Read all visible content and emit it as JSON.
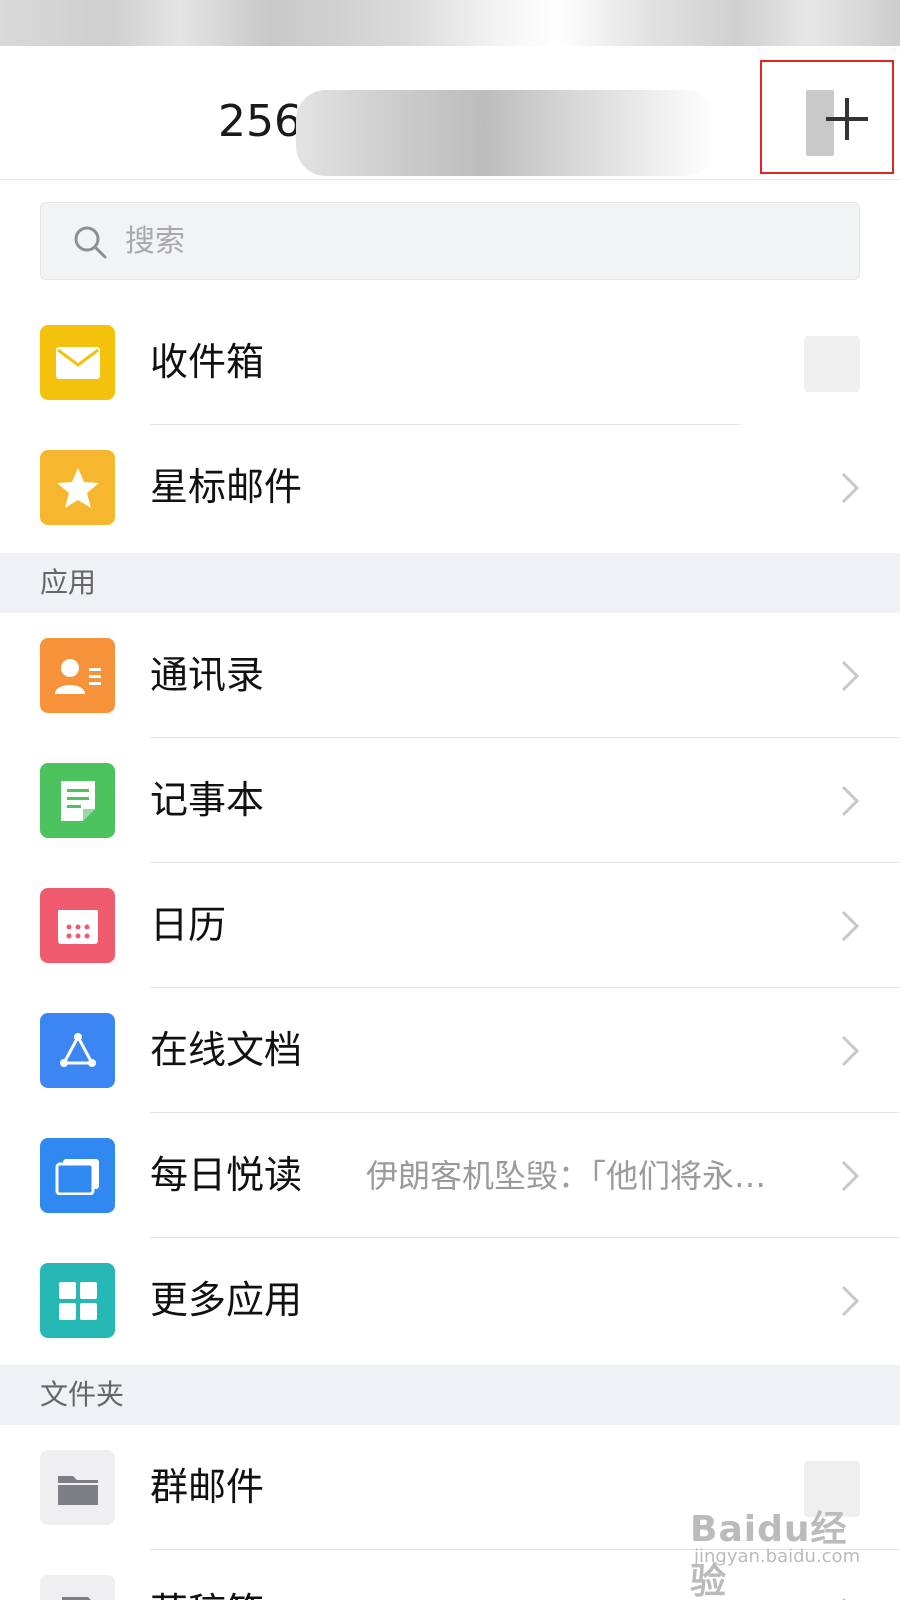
{
  "header": {
    "account_visible_text": "256",
    "add_symbol": "+"
  },
  "search": {
    "placeholder": "搜索"
  },
  "mail_items": [
    {
      "label": "收件箱",
      "icon": "envelope-icon",
      "color": "#f4c20d"
    },
    {
      "label": "星标邮件",
      "icon": "star-icon",
      "color": "#f6b72e"
    }
  ],
  "sections": {
    "apps": "应用",
    "folders": "文件夹"
  },
  "app_items": [
    {
      "label": "通讯录",
      "icon": "contacts-icon",
      "color": "#f6923a"
    },
    {
      "label": "记事本",
      "icon": "notepad-icon",
      "color": "#4cc35e"
    },
    {
      "label": "日历",
      "icon": "calendar-icon",
      "color": "#ef5a6f"
    },
    {
      "label": "在线文档",
      "icon": "docs-share-icon",
      "color": "#3b86f3"
    },
    {
      "label": "每日悦读",
      "icon": "reading-icon",
      "color": "#2f89f0",
      "subtitle": "伊朗客机坠毁：「他们将永…"
    },
    {
      "label": "更多应用",
      "icon": "grid-apps-icon",
      "color": "#25b8b4"
    }
  ],
  "folder_items": [
    {
      "label": "群邮件",
      "icon": "folder-icon",
      "color": "#efeff1"
    },
    {
      "label": "草稿箱",
      "icon": "draft-icon",
      "color": "#efeff1"
    }
  ],
  "watermark": {
    "main": "Baidu经验",
    "sub": "jingyan.baidu.com"
  },
  "colors": {
    "accent_box": "#e0261f",
    "section_bg": "#f0f1f4",
    "chevron": "#c7c7cc"
  }
}
